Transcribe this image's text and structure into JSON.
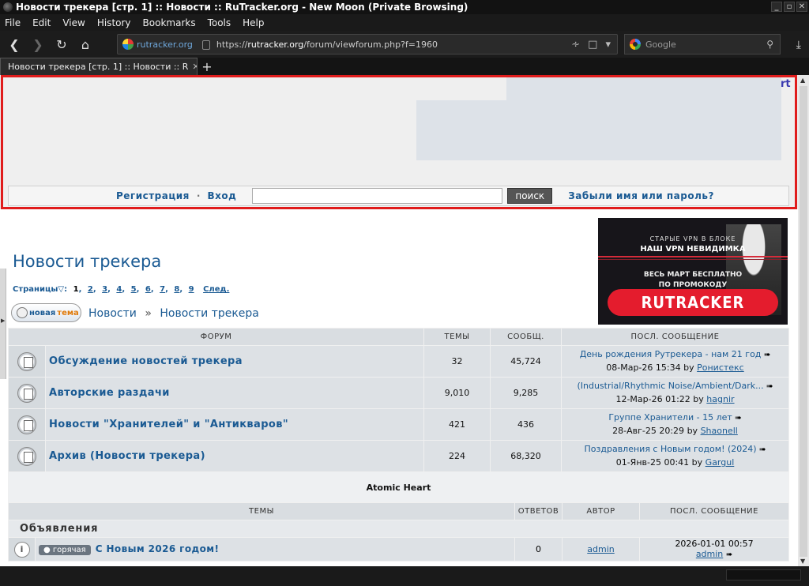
{
  "window": {
    "title": "Новости трекера [стр. 1] :: Новости :: RuTracker.org - New Moon (Private Browsing)",
    "controls": [
      "_",
      "▫",
      "✕"
    ]
  },
  "menu": [
    "File",
    "Edit",
    "View",
    "History",
    "Bookmarks",
    "Tools",
    "Help"
  ],
  "nav": {
    "site_identity": "rutracker.org",
    "url_prefix": "https://",
    "url_domain": "rutracker.org",
    "url_path": "/forum/viewforum.php?f=1960",
    "search_placeholder": "Google"
  },
  "tab": {
    "title": "Новости трекера [стр. 1] :: Новости :: R",
    "new_tab_label": "+"
  },
  "header": {
    "top_right_text": "rt",
    "login": {
      "register": "Регистрация",
      "separator": "·",
      "login": "Вход",
      "search_button": "поиск",
      "forgot": "Забыли имя или пароль?"
    }
  },
  "banner": {
    "line1": "СТАРЫЕ VPN В БЛОКЕ",
    "line2": "НАШ VPN НЕВИДИМКА",
    "line3a": "ВЕСЬ МАРТ БЕСПЛАТНО",
    "line3b": "ПО ПРОМОКОДУ",
    "promo": "RUTRACKER"
  },
  "page": {
    "title": "Новости трекера",
    "pages_label": "Страницы",
    "current_page": "1",
    "pages": [
      "2",
      "3",
      "4",
      "5",
      "6",
      "7",
      "8",
      "9"
    ],
    "next": "След.",
    "new_topic_a": "новая",
    "new_topic_b": "тема",
    "breadcrumb": [
      "Новости",
      "Новости трекера"
    ],
    "breadcrumb_sep": "»"
  },
  "forums": {
    "headers": [
      "ФОРУМ",
      "ТЕМЫ",
      "СООБЩ.",
      "ПОСЛ. СООБЩЕНИЕ"
    ],
    "rows": [
      {
        "name": "Обсуждение новостей трекера",
        "topics": "32",
        "posts": "45,724",
        "last_title": "День рождения Рутрекера - нам 21 год",
        "last_date": "08-Мар-26 15:34",
        "by": "by",
        "last_user": "Ронистекс"
      },
      {
        "name": "Авторские раздачи",
        "topics": "9,010",
        "posts": "9,285",
        "last_title": "(Industrial/Rhythmic Noise/Ambient/Dark...",
        "last_date": "12-Мар-26 01:22",
        "by": "by",
        "last_user": "hagnir"
      },
      {
        "name": "Новости \"Хранителей\" и \"Антикваров\"",
        "topics": "421",
        "posts": "436",
        "last_title": "Группе Хранители - 15 лет",
        "last_date": "28-Авг-25 20:29",
        "by": "by",
        "last_user": "Shaonell"
      },
      {
        "name": "Архив (Новости трекера)",
        "topics": "224",
        "posts": "68,320",
        "last_title": "Поздравления с Новым годом! (2024)",
        "last_date": "01-Янв-25 00:41",
        "by": "by",
        "last_user": "Gargul"
      }
    ],
    "footer": "Atomic Heart"
  },
  "topics": {
    "headers": [
      "ТЕМЫ",
      "ОТВЕТОВ",
      "АВТОР",
      "ПОСЛ. СООБЩЕНИЕ"
    ],
    "section": "Объявления",
    "rows": [
      {
        "badge": "горячая",
        "title": "С Новым 2026 годом!",
        "replies": "0",
        "author": "admin",
        "last_date": "2026-01-01 00:57",
        "last_user": "admin"
      }
    ]
  },
  "colors": {
    "link": "#1a5a93",
    "highlight_border": "#e01c1c",
    "accent": "#3a3ab0"
  }
}
